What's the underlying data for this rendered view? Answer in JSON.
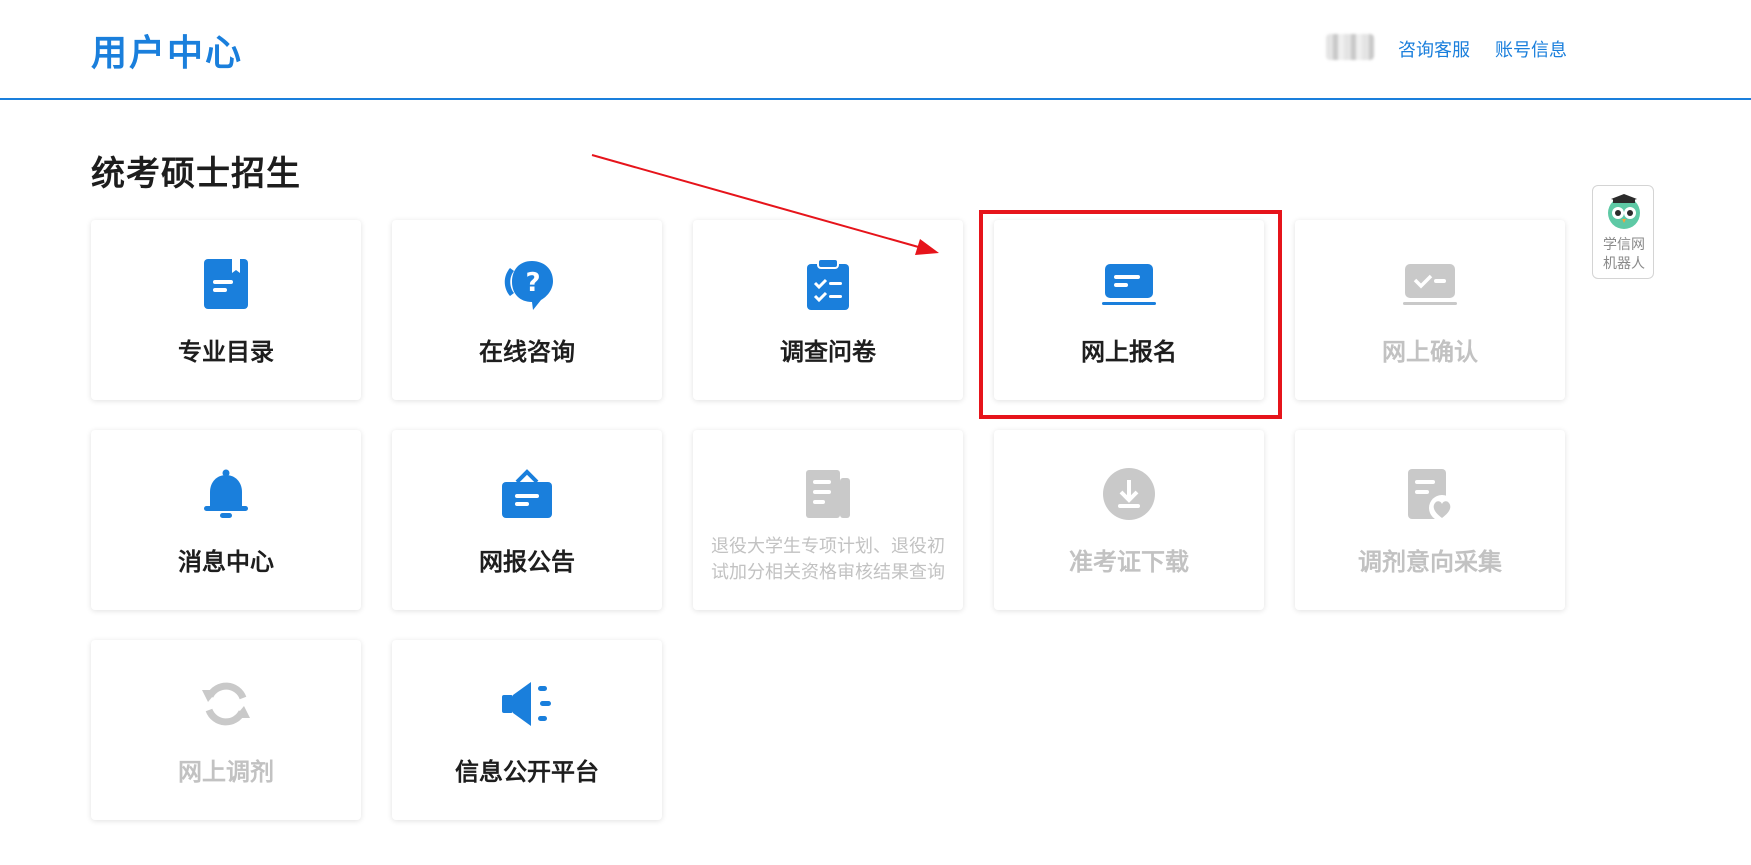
{
  "header": {
    "brand": "用户中心",
    "links": {
      "consult": "咨询客服",
      "account": "账号信息"
    }
  },
  "section": {
    "title": "统考硕士招生"
  },
  "colors": {
    "accent": "#1a7fdc",
    "disabled": "#c9c9c9",
    "highlight": "#e6141b"
  },
  "cards": [
    {
      "label": "专业目录",
      "icon": "book-icon",
      "enabled": true
    },
    {
      "label": "在线咨询",
      "icon": "chat-question-icon",
      "enabled": true
    },
    {
      "label": "调查问卷",
      "icon": "clipboard-check-icon",
      "enabled": true
    },
    {
      "label": "网上报名",
      "icon": "laptop-icon",
      "enabled": true
    },
    {
      "label": "网上确认",
      "icon": "check-card-icon",
      "enabled": false
    },
    {
      "label": "消息中心",
      "icon": "bell-icon",
      "enabled": true
    },
    {
      "label": "网报公告",
      "icon": "notice-board-icon",
      "enabled": true
    },
    {
      "label": "退役大学生专项计划、退役初试加分相关资格审核结果查询",
      "icon": "document-icon",
      "enabled": false
    },
    {
      "label": "准考证下载",
      "icon": "download-icon",
      "enabled": false
    },
    {
      "label": "调剂意向采集",
      "icon": "heart-document-icon",
      "enabled": false
    },
    {
      "label": "网上调剂",
      "icon": "refresh-icon",
      "enabled": false
    },
    {
      "label": "信息公开平台",
      "icon": "megaphone-icon",
      "enabled": true
    }
  ],
  "robot": {
    "label": "学信网机器人",
    "icon": "owl-robot-icon"
  }
}
